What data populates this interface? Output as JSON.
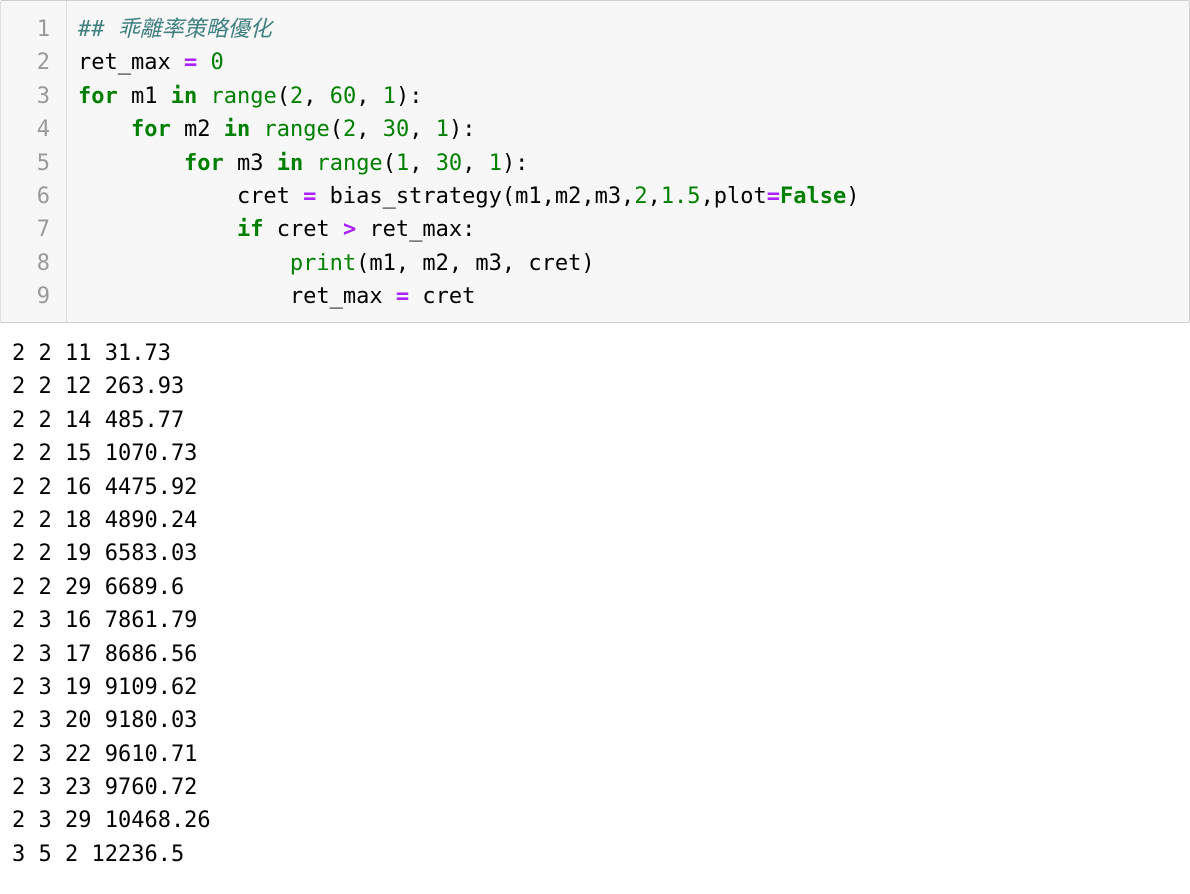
{
  "code_cell": {
    "line_numbers": [
      "1",
      "2",
      "3",
      "4",
      "5",
      "6",
      "7",
      "8",
      "9"
    ],
    "lines": [
      [
        {
          "t": "comment",
          "v": "## 乖離率策略優化"
        }
      ],
      [
        {
          "t": "name",
          "v": "ret_max "
        },
        {
          "t": "op",
          "v": "="
        },
        {
          "t": "name",
          "v": " "
        },
        {
          "t": "num",
          "v": "0"
        }
      ],
      [
        {
          "t": "kw",
          "v": "for"
        },
        {
          "t": "name",
          "v": " m1 "
        },
        {
          "t": "kw",
          "v": "in"
        },
        {
          "t": "name",
          "v": " "
        },
        {
          "t": "builtin",
          "v": "range"
        },
        {
          "t": "name",
          "v": "("
        },
        {
          "t": "num",
          "v": "2"
        },
        {
          "t": "name",
          "v": ", "
        },
        {
          "t": "num",
          "v": "60"
        },
        {
          "t": "name",
          "v": ", "
        },
        {
          "t": "num",
          "v": "1"
        },
        {
          "t": "name",
          "v": "):"
        }
      ],
      [
        {
          "t": "name",
          "v": "    "
        },
        {
          "t": "kw",
          "v": "for"
        },
        {
          "t": "name",
          "v": " m2 "
        },
        {
          "t": "kw",
          "v": "in"
        },
        {
          "t": "name",
          "v": " "
        },
        {
          "t": "builtin",
          "v": "range"
        },
        {
          "t": "name",
          "v": "("
        },
        {
          "t": "num",
          "v": "2"
        },
        {
          "t": "name",
          "v": ", "
        },
        {
          "t": "num",
          "v": "30"
        },
        {
          "t": "name",
          "v": ", "
        },
        {
          "t": "num",
          "v": "1"
        },
        {
          "t": "name",
          "v": "):"
        }
      ],
      [
        {
          "t": "name",
          "v": "        "
        },
        {
          "t": "kw",
          "v": "for"
        },
        {
          "t": "name",
          "v": " m3 "
        },
        {
          "t": "kw",
          "v": "in"
        },
        {
          "t": "name",
          "v": " "
        },
        {
          "t": "builtin",
          "v": "range"
        },
        {
          "t": "name",
          "v": "("
        },
        {
          "t": "num",
          "v": "1"
        },
        {
          "t": "name",
          "v": ", "
        },
        {
          "t": "num",
          "v": "30"
        },
        {
          "t": "name",
          "v": ", "
        },
        {
          "t": "num",
          "v": "1"
        },
        {
          "t": "name",
          "v": "):"
        }
      ],
      [
        {
          "t": "name",
          "v": "            cret "
        },
        {
          "t": "op",
          "v": "="
        },
        {
          "t": "name",
          "v": " bias_strategy(m1,m2,m3,"
        },
        {
          "t": "num",
          "v": "2"
        },
        {
          "t": "name",
          "v": ","
        },
        {
          "t": "num",
          "v": "1.5"
        },
        {
          "t": "name",
          "v": ",plot"
        },
        {
          "t": "op",
          "v": "="
        },
        {
          "t": "bool",
          "v": "False"
        },
        {
          "t": "name",
          "v": ")"
        }
      ],
      [
        {
          "t": "name",
          "v": "            "
        },
        {
          "t": "kw",
          "v": "if"
        },
        {
          "t": "name",
          "v": " cret "
        },
        {
          "t": "op",
          "v": ">"
        },
        {
          "t": "name",
          "v": " ret_max:"
        }
      ],
      [
        {
          "t": "name",
          "v": "                "
        },
        {
          "t": "builtin",
          "v": "print"
        },
        {
          "t": "name",
          "v": "(m1, m2, m3, cret)"
        }
      ],
      [
        {
          "t": "name",
          "v": "                ret_max "
        },
        {
          "t": "op",
          "v": "="
        },
        {
          "t": "name",
          "v": " cret"
        }
      ]
    ]
  },
  "output": {
    "lines": [
      "2 2 11 31.73",
      "2 2 12 263.93",
      "2 2 14 485.77",
      "2 2 15 1070.73",
      "2 2 16 4475.92",
      "2 2 18 4890.24",
      "2 2 19 6583.03",
      "2 2 29 6689.6",
      "2 3 16 7861.79",
      "2 3 17 8686.56",
      "2 3 19 9109.62",
      "2 3 20 9180.03",
      "2 3 22 9610.71",
      "2 3 23 9760.72",
      "2 3 29 10468.26",
      "3 5 2 12236.5"
    ]
  }
}
